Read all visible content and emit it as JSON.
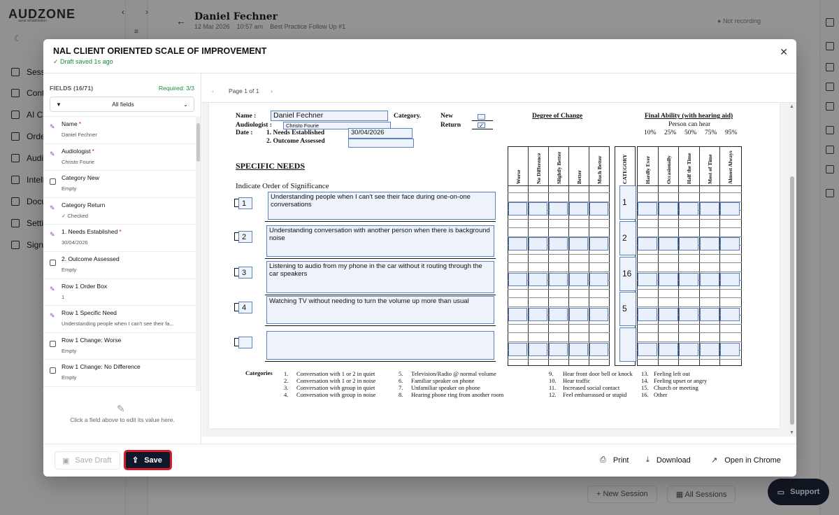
{
  "background": {
    "logo": "AUDZONE",
    "logo_sub": "aural rehabilitation",
    "nav": [
      "Sessions",
      "Contacts",
      "AI Chat",
      "Orders",
      "Audiograms",
      "Intelligence",
      "Documents",
      "Settings",
      "Sign out"
    ],
    "session_title": "Daniel Fechner",
    "session_date": "12 Mar 2026",
    "session_time": "10:57 am",
    "session_type": "Best Practice Follow Up #1",
    "recording_status": "Not recording",
    "new_session": "New Session",
    "all_sessions": "All Sessions",
    "support": "Support"
  },
  "modal": {
    "title": "NAL CLIENT ORIENTED SCALE OF IMPROVEMENT",
    "draft_status": "✓ Draft saved 1s ago",
    "fields_count": "FIELDS (16/71)",
    "required": "Required: 3/3",
    "filter": "All fields",
    "hint": "Click a field above to edit its value here.",
    "page_indicator": "Page 1 of 1",
    "fields": [
      {
        "label": "Name",
        "value": "Daniel Fechner",
        "required": "*",
        "kind": "sig"
      },
      {
        "label": "Audiologist",
        "value": "Christo Fourie",
        "required": "*",
        "kind": "sig"
      },
      {
        "label": "Category New",
        "value": "Empty",
        "required": "",
        "kind": "chk"
      },
      {
        "label": "Category Return",
        "value": "✓ Checked",
        "required": "",
        "kind": "sig"
      },
      {
        "label": "1. Needs Established",
        "value": "30/04/2026",
        "required": "*",
        "kind": "sig"
      },
      {
        "label": "2. Outcome Assessed",
        "value": "Empty",
        "required": "",
        "kind": "chk"
      },
      {
        "label": "Row 1 Order Box",
        "value": "1",
        "required": "",
        "kind": "sig"
      },
      {
        "label": "Row 1 Specific Need",
        "value": "Understanding people when I can't see their fa...",
        "required": "",
        "kind": "sig"
      },
      {
        "label": "Row 1 Change: Worse",
        "value": "Empty",
        "required": "",
        "kind": "chk"
      },
      {
        "label": "Row 1 Change: No Difference",
        "value": "Empty",
        "required": "",
        "kind": "chk"
      }
    ],
    "buttons": {
      "save_draft": "Save Draft",
      "save": "Save",
      "print": "Print",
      "download": "Download",
      "open_chrome": "Open in Chrome"
    }
  },
  "form": {
    "name_label": "Name :",
    "name_value": "Daniel Fechner",
    "audiologist_label": "Audiologist :",
    "audiologist_value": "Christo Fourie",
    "date_label": "Date :",
    "needs_label": "1. Needs Established",
    "needs_value": "30/04/2026",
    "outcome_label": "2. Outcome Assessed",
    "outcome_value": "",
    "category_label": "Category.",
    "new_label": "New",
    "return_label": "Return",
    "return_checked": "✓",
    "degree_title": "Degree of Change",
    "final_title": "Final Ability (with hearing aid)",
    "person_can_hear": "Person can hear",
    "percents": [
      "10%",
      "25%",
      "50%",
      "75%",
      "95%"
    ],
    "degree_cols": [
      "Worse",
      "No Difference",
      "Slightly Better",
      "Better",
      "Much Better"
    ],
    "category_col": "CATEGORY",
    "final_cols": [
      "Hardly Ever",
      "Occasionally",
      "Half the Time",
      "Most of Time",
      "Almost Always"
    ],
    "specific_needs": "SPECIFIC NEEDS",
    "indicate_order": "Indicate Order of Significance",
    "rows": [
      {
        "order": "1",
        "need": "Understanding people when I can't see their face during one-on-one conversations",
        "category": "1"
      },
      {
        "order": "2",
        "need": "Understanding conversation with another person when there is background noise",
        "category": "2"
      },
      {
        "order": "3",
        "need": "Listening to audio from my phone in the car without it routing through the car speakers",
        "category": "16"
      },
      {
        "order": "4",
        "need": "Watching TV without needing to turn the volume up more than usual",
        "category": "5"
      },
      {
        "order": "",
        "need": "",
        "category": ""
      }
    ],
    "categories_label": "Categories",
    "categories": [
      [
        "1.",
        "Conversation with 1 or 2 in quiet"
      ],
      [
        "2.",
        "Conversation with 1 or 2 in noise"
      ],
      [
        "3.",
        "Conversation with group in quiet"
      ],
      [
        "4.",
        "Conversation with group in noise"
      ],
      [
        "5.",
        "Television/Radio @ normal volume"
      ],
      [
        "6.",
        "Familiar speaker on phone"
      ],
      [
        "7.",
        "Unfamiliar speaker on phone"
      ],
      [
        "8.",
        "Hearing phone ring from another room"
      ],
      [
        "9.",
        "Hear front door bell or knock"
      ],
      [
        "10.",
        "Hear traffic"
      ],
      [
        "11.",
        "Increased social contact"
      ],
      [
        "12.",
        "Feel embarrassed or stupid"
      ],
      [
        "13.",
        "Feeling left out"
      ],
      [
        "14.",
        "Feeling upset or angry"
      ],
      [
        "15.",
        "Church or meeting"
      ],
      [
        "16.",
        "Other"
      ]
    ]
  }
}
